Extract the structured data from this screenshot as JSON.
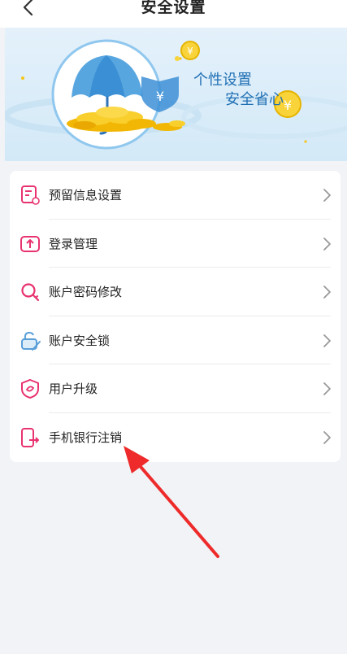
{
  "header": {
    "title": "安全设置",
    "back_icon": "chevron-left-icon"
  },
  "banner": {
    "slogan_line1": "个性设置",
    "slogan_line2": "安全省心",
    "illustration": "umbrella-coins-shield-illustration"
  },
  "menu": {
    "items": [
      {
        "label": "预留信息设置",
        "icon": "document-settings-icon"
      },
      {
        "label": "登录管理",
        "icon": "upload-box-icon"
      },
      {
        "label": "账户密码修改",
        "icon": "key-icon"
      },
      {
        "label": "账户安全锁",
        "icon": "lock-icon"
      },
      {
        "label": "用户升级",
        "icon": "shield-icon"
      },
      {
        "label": "手机银行注销",
        "icon": "phone-logout-icon"
      }
    ]
  },
  "annotation": {
    "type": "red-arrow",
    "target": "手机银行注销"
  },
  "colors": {
    "icon_pink": "#e8336f",
    "icon_blue": "#5a9fd8",
    "annotation_red": "#ee2a2a",
    "title_blue": "#1f6fb4"
  }
}
